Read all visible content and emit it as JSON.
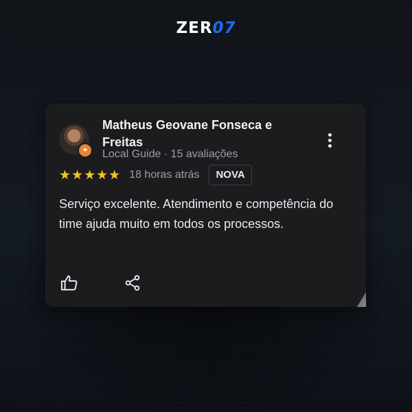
{
  "brand": {
    "logo_main": "ZER",
    "logo_accent": "07"
  },
  "review_card": {
    "reviewer_name": "Matheus Geovane Fonseca e Freitas",
    "reviewer_subtitle": "Local Guide · 15 avaliações",
    "rating": 5,
    "stars_display": "★★★★★",
    "time_ago": "18 horas atrás",
    "new_badge": "NOVA",
    "review_text": "Serviço excelente. Atendimento e competência do time ajuda muito em todos os processos.",
    "local_guide_badge_icon": "✦",
    "icons": [
      "more-options-icon",
      "thumbs-up-icon",
      "share-icon"
    ]
  },
  "colors": {
    "star": "#f7c31f",
    "logo_accent": "#1e6cf0",
    "card_background": "#1c1c1f",
    "local_guide_badge": "#e8833a"
  }
}
